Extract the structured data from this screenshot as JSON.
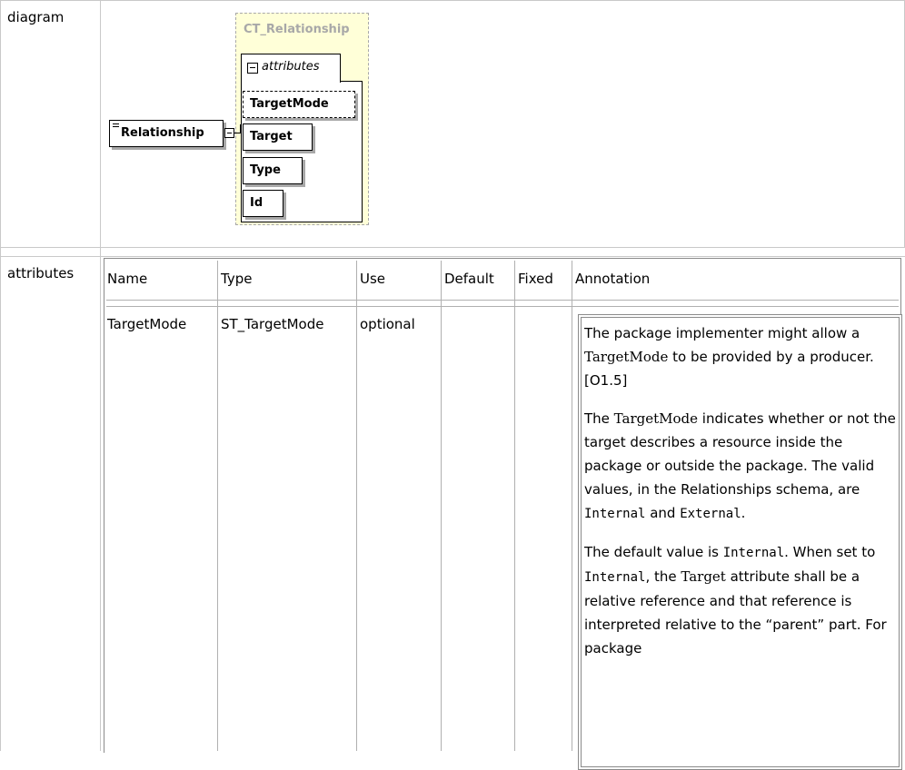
{
  "labels": {
    "diagram": "diagram",
    "attributes": "attributes"
  },
  "diagram": {
    "complex_type": "CT_Relationship",
    "attributes_group": "attributes",
    "element": "Relationship",
    "attributes": [
      "TargetMode",
      "Target",
      "Type",
      "Id"
    ]
  },
  "table": {
    "headers": [
      "Name",
      "Type",
      "Use",
      "Default",
      "Fixed",
      "Annotation"
    ],
    "row": {
      "name": "TargetMode",
      "type": "ST_TargetMode",
      "use": "optional",
      "default": "",
      "fixed": ""
    }
  },
  "annotation": {
    "p1_a": "The package implementer might allow a ",
    "p1_code": "TargetMode",
    "p1_b": " to be provided by a producer. [O1.5]",
    "p2_a": "The ",
    "p2_code": "TargetMode",
    "p2_b": " indicates whether or not the target describes a resource inside the package or outside the package. The valid values, in the Relationships schema, are ",
    "p2_mono1": "Internal",
    "p2_c": " and ",
    "p2_mono2": "External",
    "p2_d": ".",
    "p3_a": "The default value is ",
    "p3_mono1": "Internal",
    "p3_b": ". When set to ",
    "p3_mono2": "Internal",
    "p3_c": ", the ",
    "p3_serif": "Target",
    "p3_d": " attribute shall be a relative reference and that reference is interpreted relative to the “parent” part. For package"
  }
}
